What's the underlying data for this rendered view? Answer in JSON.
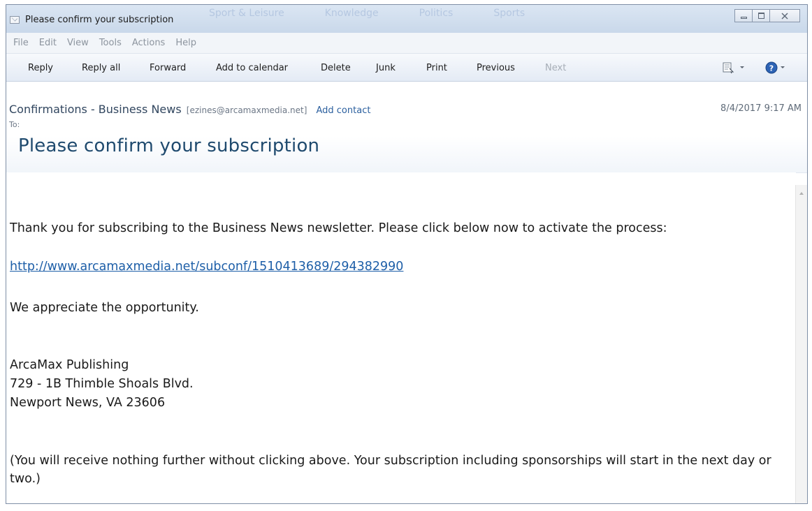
{
  "window": {
    "title": "Please confirm your subscription",
    "background_tabs": [
      "Sport & Leisure",
      "Knowledge",
      "Politics",
      "Sports"
    ]
  },
  "menu": [
    "File",
    "Edit",
    "View",
    "Tools",
    "Actions",
    "Help"
  ],
  "toolbar": {
    "reply": "Reply",
    "reply_all": "Reply all",
    "forward": "Forward",
    "add_to_calendar": "Add to calendar",
    "delete": "Delete",
    "junk": "Junk",
    "print": "Print",
    "previous": "Previous",
    "next": "Next"
  },
  "header": {
    "sender_name": "Confirmations - Business News",
    "sender_email": "[ezines@arcamaxmedia.net]",
    "add_contact": "Add contact",
    "date": "8/4/2017 9:17 AM",
    "to_label": "To:",
    "to_value": "",
    "subject": "Please confirm your subscription"
  },
  "body": {
    "intro": "Thank you for subscribing to the Business News newsletter. Please click below now to activate the process:",
    "link": "http://www.arcamaxmedia.net/subconf/1510413689/294382990",
    "appreciation": "We appreciate the opportunity.",
    "address_line1": "ArcaMax Publishing",
    "address_line2": "729 - 1B Thimble Shoals Blvd.",
    "address_line3": "Newport News, VA 23606",
    "footer_note": "(You will receive nothing further without clicking above.  Your subscription including sponsorships will start in the next day or two.)"
  },
  "icons": {
    "window_icon": "envelope-icon",
    "view_icon": "message-view-icon",
    "help_icon": "help-icon"
  },
  "colors": {
    "link": "#1e5fa8",
    "subject": "#1f4a6e",
    "add_contact": "#2b5f9e"
  }
}
